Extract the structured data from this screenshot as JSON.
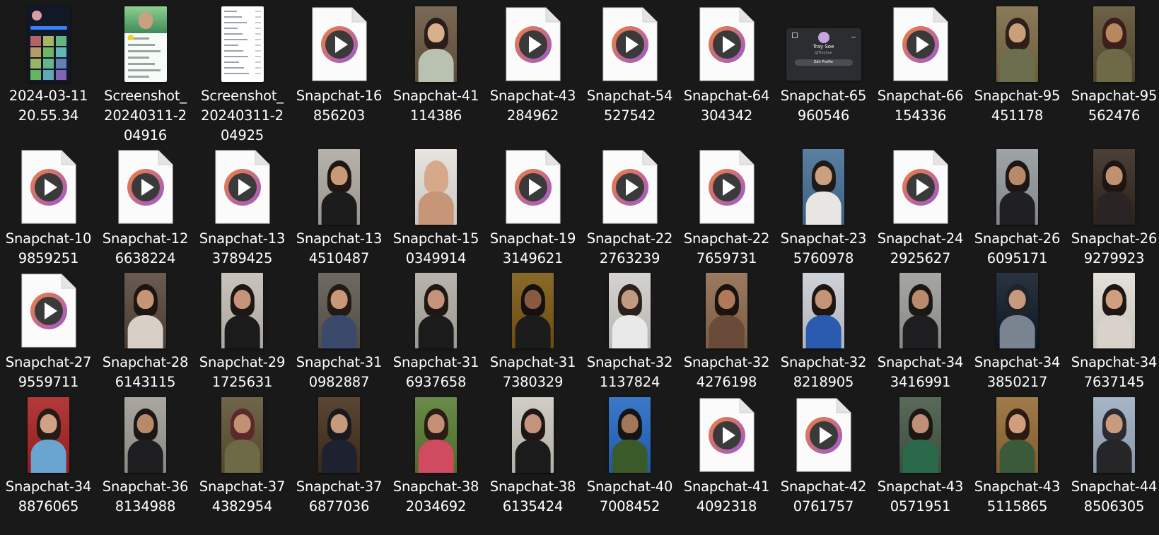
{
  "view": "File Explorer large icons view",
  "icons": {
    "video": "play-button-document-icon",
    "photo": "image-thumbnail",
    "screenshot": "screenshot-thumbnail"
  },
  "colors": {
    "background": "#191919",
    "label_text": "#ffffff",
    "play_ring_start": "#f0803c",
    "play_ring_end": "#9b59d0",
    "play_center": "#3a3a3a"
  },
  "files": [
    {
      "line1": "2024-03-11",
      "line2": "20.55.34",
      "line3": "",
      "kind": "screenshot",
      "tone": [
        "#111827",
        "#3b82f6"
      ]
    },
    {
      "line1": "Screenshot_",
      "line2": "20240311-2",
      "line3": "04916",
      "kind": "screenshot",
      "tone": [
        "#f7fbf7",
        "#5aa15a"
      ]
    },
    {
      "line1": "Screenshot_",
      "line2": "20240311-2",
      "line3": "04925",
      "kind": "screenshot",
      "tone": [
        "#ffffff",
        "#9ca3af"
      ]
    },
    {
      "line1": "Snapchat-16",
      "line2": "856203",
      "line3": "",
      "kind": "video"
    },
    {
      "line1": "Snapchat-41",
      "line2": "114386",
      "line3": "",
      "kind": "photo",
      "tone": [
        "#7a6a55",
        "#d8b08c",
        "#2a1e18",
        "#b9c2b0"
      ]
    },
    {
      "line1": "Snapchat-43",
      "line2": "284962",
      "line3": "",
      "kind": "video"
    },
    {
      "line1": "Snapchat-54",
      "line2": "527542",
      "line3": "",
      "kind": "video"
    },
    {
      "line1": "Snapchat-64",
      "line2": "304342",
      "line3": "",
      "kind": "video"
    },
    {
      "line1": "Snapchat-65",
      "line2": "960546",
      "line3": "",
      "kind": "profile",
      "profile_name": "Tray Soe",
      "profile_handle": "@TraySoe",
      "profile_button": "Edit Profile"
    },
    {
      "line1": "Snapchat-66",
      "line2": "154336",
      "line3": "",
      "kind": "video"
    },
    {
      "line1": "Snapchat-95",
      "line2": "451178",
      "line3": "",
      "kind": "photo",
      "tone": [
        "#8a7a5a",
        "#c9a07a",
        "#2c2018",
        "#6b6f4e"
      ]
    },
    {
      "line1": "Snapchat-95",
      "line2": "562476",
      "line3": "",
      "kind": "photo",
      "tone": [
        "#6d6248",
        "#b8865f",
        "#3a1f1a",
        "#6e6a48"
      ]
    },
    {
      "line1": "Snapchat-10",
      "line2": "9859251",
      "line3": "",
      "kind": "video"
    },
    {
      "line1": "Snapchat-12",
      "line2": "6638224",
      "line3": "",
      "kind": "video"
    },
    {
      "line1": "Snapchat-13",
      "line2": "3789425",
      "line3": "",
      "kind": "video"
    },
    {
      "line1": "Snapchat-13",
      "line2": "4510487",
      "line3": "",
      "kind": "photo",
      "tone": [
        "#b7b2aa",
        "#c89a78",
        "#1e1714",
        "#1c1c1c"
      ]
    },
    {
      "line1": "Snapchat-15",
      "line2": "0349914",
      "line3": "",
      "kind": "photo",
      "tone": [
        "#e8e4e0",
        "#d6a98a",
        "#d6a98a",
        "#c79577"
      ]
    },
    {
      "line1": "Snapchat-19",
      "line2": "3149621",
      "line3": "",
      "kind": "video"
    },
    {
      "line1": "Snapchat-22",
      "line2": "2763239",
      "line3": "",
      "kind": "video"
    },
    {
      "line1": "Snapchat-22",
      "line2": "7659731",
      "line3": "",
      "kind": "video"
    },
    {
      "line1": "Snapchat-23",
      "line2": "5760978",
      "line3": "",
      "kind": "photo",
      "tone": [
        "#5a7fa0",
        "#caa080",
        "#1e1a18",
        "#e8e6e2"
      ]
    },
    {
      "line1": "Snapchat-24",
      "line2": "2925627",
      "line3": "",
      "kind": "video"
    },
    {
      "line1": "Snapchat-26",
      "line2": "6095171",
      "line3": "",
      "kind": "photo",
      "tone": [
        "#9fa4a6",
        "#b88a6a",
        "#1b1716",
        "#202022"
      ]
    },
    {
      "line1": "Snapchat-26",
      "line2": "9279923",
      "line3": "",
      "kind": "photo",
      "tone": [
        "#4a4038",
        "#c09070",
        "#1d1512",
        "#2a2424"
      ]
    },
    {
      "line1": "Snapchat-27",
      "line2": "9559711",
      "line3": "",
      "kind": "video"
    },
    {
      "line1": "Snapchat-28",
      "line2": "6143115",
      "line3": "",
      "kind": "photo",
      "tone": [
        "#6a5b52",
        "#c59576",
        "#1c1512",
        "#d8cfc7"
      ]
    },
    {
      "line1": "Snapchat-29",
      "line2": "1725631",
      "line3": "",
      "kind": "photo",
      "tone": [
        "#c9c4bd",
        "#c4937a",
        "#1e1714",
        "#1b1b1b"
      ]
    },
    {
      "line1": "Snapchat-31",
      "line2": "0982887",
      "line3": "",
      "kind": "photo",
      "tone": [
        "#6f6a62",
        "#c9987a",
        "#221a16",
        "#3b4a6a"
      ]
    },
    {
      "line1": "Snapchat-31",
      "line2": "6937658",
      "line3": "",
      "kind": "photo",
      "tone": [
        "#b9b5ae",
        "#c4937a",
        "#1e1714",
        "#1b1b1b"
      ]
    },
    {
      "line1": "Snapchat-31",
      "line2": "7380329",
      "line3": "",
      "kind": "photo",
      "tone": [
        "#8a6a2a",
        "#8a5a40",
        "#141010",
        "#1c1c1c"
      ]
    },
    {
      "line1": "Snapchat-32",
      "line2": "1137824",
      "line3": "",
      "kind": "photo",
      "tone": [
        "#d5d3cf",
        "#c29a80",
        "#2a211c",
        "#e9e9e9"
      ]
    },
    {
      "line1": "Snapchat-32",
      "line2": "4276198",
      "line3": "",
      "kind": "photo",
      "tone": [
        "#9a7a60",
        "#b07a58",
        "#1b1310",
        "#6a4a38"
      ]
    },
    {
      "line1": "Snapchat-32",
      "line2": "8218905",
      "line3": "",
      "kind": "photo",
      "tone": [
        "#cfd2d8",
        "#c49476",
        "#1d1612",
        "#2a5bb0"
      ]
    },
    {
      "line1": "Snapchat-34",
      "line2": "3416991",
      "line3": "",
      "kind": "photo",
      "tone": [
        "#a6a7a4",
        "#b98a6c",
        "#1b1715",
        "#1e1e20"
      ]
    },
    {
      "line1": "Snapchat-34",
      "line2": "3850217",
      "line3": "",
      "kind": "photo",
      "tone": [
        "#2a3440",
        "#c79a80",
        "#202429",
        "#7a8490"
      ]
    },
    {
      "line1": "Snapchat-34",
      "line2": "7637145",
      "line3": "",
      "kind": "photo",
      "tone": [
        "#e4e0da",
        "#cf9f80",
        "#1e1714",
        "#d9d2ca"
      ]
    },
    {
      "line1": "Snapchat-34",
      "line2": "8876065",
      "line3": "",
      "kind": "photo",
      "tone": [
        "#b23a3a",
        "#d2a084",
        "#241a16",
        "#6aa5d0"
      ]
    },
    {
      "line1": "Snapchat-36",
      "line2": "8134988",
      "line3": "",
      "kind": "photo",
      "tone": [
        "#a9a6a0",
        "#b88a6a",
        "#1b1715",
        "#1e1e20"
      ]
    },
    {
      "line1": "Snapchat-37",
      "line2": "4382954",
      "line3": "",
      "kind": "photo",
      "tone": [
        "#70654a",
        "#c29072",
        "#5a2a2a",
        "#6e6a48"
      ]
    },
    {
      "line1": "Snapchat-37",
      "line2": "6877036",
      "line3": "",
      "kind": "photo",
      "tone": [
        "#5a4634",
        "#c69a7a",
        "#1a1a1e",
        "#1e2230"
      ]
    },
    {
      "line1": "Snapchat-38",
      "line2": "2034692",
      "line3": "",
      "kind": "photo",
      "tone": [
        "#6a8a4a",
        "#c49074",
        "#2a1c16",
        "#d04a60"
      ]
    },
    {
      "line1": "Snapchat-38",
      "line2": "6135424",
      "line3": "",
      "kind": "photo",
      "tone": [
        "#d0ccc6",
        "#c4937a",
        "#1e1714",
        "#1b1b1b"
      ]
    },
    {
      "line1": "Snapchat-40",
      "line2": "7008452",
      "line3": "",
      "kind": "photo",
      "tone": [
        "#3c78c8",
        "#a2765a",
        "#141414",
        "#3a5a2a"
      ]
    },
    {
      "line1": "Snapchat-41",
      "line2": "4092318",
      "line3": "",
      "kind": "video"
    },
    {
      "line1": "Snapchat-42",
      "line2": "0761757",
      "line3": "",
      "kind": "video"
    },
    {
      "line1": "Snapchat-43",
      "line2": "0571951",
      "line3": "",
      "kind": "photo",
      "tone": [
        "#5a6a5a",
        "#c09074",
        "#1c1614",
        "#2a6a4a"
      ]
    },
    {
      "line1": "Snapchat-43",
      "line2": "5115865",
      "line3": "",
      "kind": "photo",
      "tone": [
        "#a07a4a",
        "#cf9e7c",
        "#2a1a12",
        "#3a5a3a"
      ]
    },
    {
      "line1": "Snapchat-44",
      "line2": "8506305",
      "line3": "",
      "kind": "photo",
      "tone": [
        "#a6b6c6",
        "#c89a7e",
        "#2a2a30",
        "#262628"
      ]
    }
  ]
}
